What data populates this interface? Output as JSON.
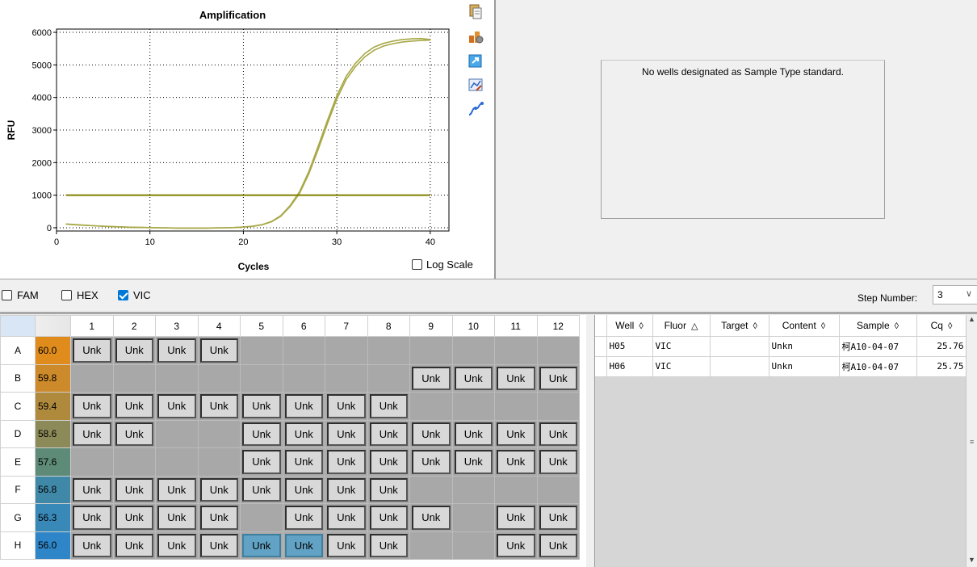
{
  "chart": {
    "toolbar": [
      {
        "name": "copy-icon",
        "color": "#c8a040"
      },
      {
        "name": "properties-icon",
        "color": "#c86828"
      },
      {
        "name": "export-icon",
        "color": "#2a8ad8"
      },
      {
        "name": "chart-settings-icon",
        "color": "#5080c0"
      },
      {
        "name": "trace-style-icon",
        "color": "#2a6ad8"
      }
    ],
    "log_scale_label": "Log Scale",
    "log_scale_checked": false
  },
  "chart_data": {
    "type": "line",
    "title": "Amplification",
    "xlabel": "Cycles",
    "ylabel": "RFU",
    "xlim": [
      0,
      42
    ],
    "ylim": [
      -100,
      6100
    ],
    "xticks": [
      0,
      10,
      20,
      30,
      40
    ],
    "yticks": [
      0,
      1000,
      2000,
      3000,
      4000,
      5000,
      6000
    ],
    "grid": "dotted",
    "threshold": 1000,
    "series": [
      {
        "color": "#a8a848",
        "x": [
          1,
          2,
          3,
          4,
          5,
          6,
          7,
          8,
          9,
          10,
          11,
          12,
          13,
          14,
          15,
          16,
          17,
          18,
          19,
          20,
          21,
          22,
          23,
          24,
          25,
          26,
          27,
          28,
          29,
          30,
          31,
          32,
          33,
          34,
          35,
          36,
          37,
          38,
          39,
          40
        ],
        "y": [
          110,
          90,
          75,
          60,
          45,
          35,
          25,
          15,
          10,
          5,
          0,
          -5,
          -10,
          -10,
          -10,
          -10,
          -5,
          0,
          5,
          20,
          45,
          90,
          180,
          350,
          650,
          1050,
          1650,
          2400,
          3200,
          3950,
          4550,
          4950,
          5250,
          5450,
          5580,
          5650,
          5700,
          5730,
          5750,
          5760
        ]
      },
      {
        "color": "#a8a848",
        "x": [
          1,
          2,
          3,
          4,
          5,
          6,
          7,
          8,
          9,
          10,
          11,
          12,
          13,
          14,
          15,
          16,
          17,
          18,
          19,
          20,
          21,
          22,
          23,
          24,
          25,
          26,
          27,
          28,
          29,
          30,
          31,
          32,
          33,
          34,
          35,
          36,
          37,
          38,
          39,
          40
        ],
        "y": [
          115,
          95,
          78,
          62,
          48,
          36,
          26,
          16,
          10,
          5,
          0,
          -5,
          -10,
          -10,
          -10,
          -10,
          -5,
          0,
          6,
          22,
          48,
          95,
          190,
          370,
          680,
          1100,
          1720,
          2500,
          3300,
          4050,
          4650,
          5050,
          5350,
          5550,
          5660,
          5730,
          5780,
          5800,
          5810,
          5780
        ]
      }
    ]
  },
  "standard": {
    "message": "No wells designated as Sample Type standard."
  },
  "fluors": [
    {
      "label": "FAM",
      "checked": false
    },
    {
      "label": "HEX",
      "checked": false
    },
    {
      "label": "VIC",
      "checked": true
    }
  ],
  "step": {
    "label": "Step Number:",
    "value": "3"
  },
  "plate": {
    "columns": [
      "1",
      "2",
      "3",
      "4",
      "5",
      "6",
      "7",
      "8",
      "9",
      "10",
      "11",
      "12"
    ],
    "rows": [
      {
        "label": "A",
        "temp": "60.0",
        "color": "#e08c1c",
        "wells": [
          1,
          1,
          1,
          1,
          0,
          0,
          0,
          0,
          0,
          0,
          0,
          0
        ]
      },
      {
        "label": "B",
        "temp": "59.8",
        "color": "#cc8a2a",
        "wells": [
          0,
          0,
          0,
          0,
          0,
          0,
          0,
          0,
          1,
          1,
          1,
          1
        ]
      },
      {
        "label": "C",
        "temp": "59.4",
        "color": "#b08a3c",
        "wells": [
          1,
          1,
          1,
          1,
          1,
          1,
          1,
          1,
          0,
          0,
          0,
          0
        ]
      },
      {
        "label": "D",
        "temp": "58.6",
        "color": "#8c8a58",
        "wells": [
          1,
          1,
          0,
          0,
          1,
          1,
          1,
          1,
          1,
          1,
          1,
          1
        ]
      },
      {
        "label": "E",
        "temp": "57.6",
        "color": "#5e8a78",
        "wells": [
          0,
          0,
          0,
          0,
          1,
          1,
          1,
          1,
          1,
          1,
          1,
          1
        ]
      },
      {
        "label": "F",
        "temp": "56.8",
        "color": "#4088a8",
        "wells": [
          1,
          1,
          1,
          1,
          1,
          1,
          1,
          1,
          0,
          0,
          0,
          0
        ]
      },
      {
        "label": "G",
        "temp": "56.3",
        "color": "#3888b8",
        "wells": [
          1,
          1,
          1,
          1,
          0,
          1,
          1,
          1,
          1,
          0,
          1,
          1
        ]
      },
      {
        "label": "H",
        "temp": "56.0",
        "color": "#2e86c8",
        "wells": [
          1,
          1,
          1,
          1,
          2,
          2,
          1,
          1,
          0,
          0,
          1,
          1
        ]
      }
    ],
    "well_text": "Unk"
  },
  "results": {
    "headers": [
      "Well",
      "Fluor",
      "Target",
      "Content",
      "Sample",
      "Cq"
    ],
    "sort_marks": [
      "◊",
      "△",
      "◊",
      "◊",
      "◊",
      "◊"
    ],
    "rows": [
      {
        "well": "H05",
        "fluor": "VIC",
        "target": "",
        "content": "Unkn",
        "sample": "柯A10-04-07",
        "cq": "25.76"
      },
      {
        "well": "H06",
        "fluor": "VIC",
        "target": "",
        "content": "Unkn",
        "sample": "柯A10-04-07",
        "cq": "25.75"
      }
    ]
  }
}
